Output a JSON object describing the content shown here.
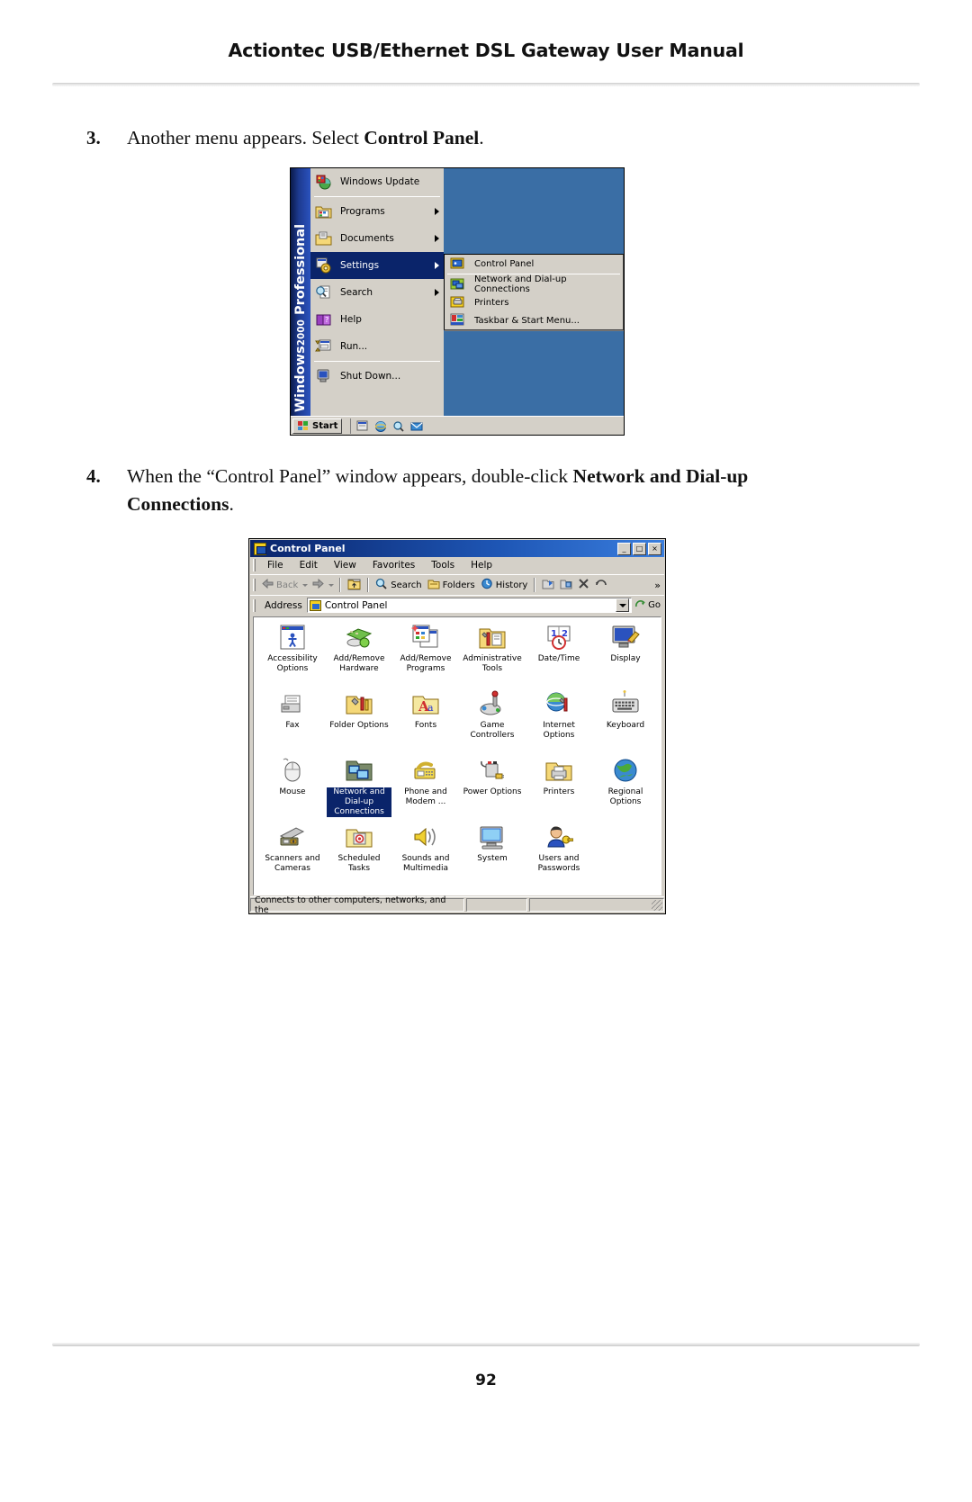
{
  "header": {
    "title": "Actiontec USB/Ethernet DSL Gateway User Manual"
  },
  "footer": {
    "page_number": "92"
  },
  "steps": [
    {
      "number": "3.",
      "text_before": "Another menu appears. Select ",
      "bold_1": "Control Panel",
      "text_after": "."
    },
    {
      "number": "4.",
      "text_before": "When the “Control Panel” window appears, double-click ",
      "bold_1": "Network and Dial-up Connections",
      "text_after": "."
    }
  ],
  "start_menu": {
    "banner_windows": "Windows",
    "banner_2000": "2000",
    "banner_professional": "Professional",
    "items": [
      {
        "label": "Windows Update",
        "icon": "windows-update-icon",
        "arrow": false,
        "selected": false
      },
      {
        "label": "Programs",
        "icon": "programs-folder-icon",
        "arrow": true,
        "selected": false
      },
      {
        "label": "Documents",
        "icon": "documents-folder-icon",
        "arrow": true,
        "selected": false
      },
      {
        "label": "Settings",
        "icon": "settings-gear-icon",
        "arrow": true,
        "selected": true
      },
      {
        "label": "Search",
        "icon": "search-magnifier-icon",
        "arrow": true,
        "selected": false
      },
      {
        "label": "Help",
        "icon": "help-book-icon",
        "arrow": false,
        "selected": false
      },
      {
        "label": "Run...",
        "icon": "run-icon",
        "arrow": false,
        "selected": false
      },
      {
        "label": "Shut Down...",
        "icon": "shutdown-icon",
        "arrow": false,
        "selected": false
      }
    ],
    "submenu": [
      {
        "label": "Control Panel",
        "icon": "control-panel-icon"
      },
      {
        "label": "Network and Dial-up Connections",
        "icon": "network-connections-icon"
      },
      {
        "label": "Printers",
        "icon": "printers-icon"
      },
      {
        "label": "Taskbar & Start Menu...",
        "icon": "taskbar-start-menu-icon"
      }
    ],
    "taskbar": {
      "start_label": "Start",
      "quick_launch": [
        "show-desktop-icon",
        "internet-explorer-icon",
        "search-icon",
        "outlook-express-icon"
      ]
    }
  },
  "control_panel": {
    "title": "Control Panel",
    "window_buttons": {
      "minimize": "_",
      "maximize": "□",
      "close": "×"
    },
    "menu": [
      {
        "label": "File",
        "accel": "F"
      },
      {
        "label": "Edit",
        "accel": "E"
      },
      {
        "label": "View",
        "accel": "V"
      },
      {
        "label": "Favorites",
        "accel": "a"
      },
      {
        "label": "Tools",
        "accel": "T"
      },
      {
        "label": "Help",
        "accel": "H"
      }
    ],
    "toolbar": {
      "back": "Back",
      "forward": "",
      "up": "",
      "search": "Search",
      "folders": "Folders",
      "history": "History",
      "chevron": "»"
    },
    "address": {
      "label": "Address",
      "value": "Control Panel",
      "go_label": "Go"
    },
    "items": [
      {
        "label": "Accessibility Options",
        "icon": "accessibility-options-icon",
        "selected": false
      },
      {
        "label": "Add/Remove Hardware",
        "icon": "add-remove-hardware-icon",
        "selected": false
      },
      {
        "label": "Add/Remove Programs",
        "icon": "add-remove-programs-icon",
        "selected": false
      },
      {
        "label": "Administrative Tools",
        "icon": "administrative-tools-icon",
        "selected": false
      },
      {
        "label": "Date/Time",
        "icon": "date-time-icon",
        "selected": false
      },
      {
        "label": "Display",
        "icon": "display-icon",
        "selected": false
      },
      {
        "label": "Fax",
        "icon": "fax-icon",
        "selected": false
      },
      {
        "label": "Folder Options",
        "icon": "folder-options-icon",
        "selected": false
      },
      {
        "label": "Fonts",
        "icon": "fonts-icon",
        "selected": false
      },
      {
        "label": "Game Controllers",
        "icon": "game-controllers-icon",
        "selected": false
      },
      {
        "label": "Internet Options",
        "icon": "internet-options-icon",
        "selected": false
      },
      {
        "label": "Keyboard",
        "icon": "keyboard-icon",
        "selected": false
      },
      {
        "label": "Mouse",
        "icon": "mouse-icon",
        "selected": false
      },
      {
        "label": "Network and Dial-up Connections",
        "icon": "network-connections-icon",
        "selected": true
      },
      {
        "label": "Phone and Modem ...",
        "icon": "phone-modem-icon",
        "selected": false
      },
      {
        "label": "Power Options",
        "icon": "power-options-icon",
        "selected": false
      },
      {
        "label": "Printers",
        "icon": "printers-icon",
        "selected": false
      },
      {
        "label": "Regional Options",
        "icon": "regional-options-icon",
        "selected": false
      },
      {
        "label": "Scanners and Cameras",
        "icon": "scanners-cameras-icon",
        "selected": false
      },
      {
        "label": "Scheduled Tasks",
        "icon": "scheduled-tasks-icon",
        "selected": false
      },
      {
        "label": "Sounds and Multimedia",
        "icon": "sounds-multimedia-icon",
        "selected": false
      },
      {
        "label": "System",
        "icon": "system-icon",
        "selected": false
      },
      {
        "label": "Users and Passwords",
        "icon": "users-passwords-icon",
        "selected": false
      }
    ],
    "status_bar": {
      "text": "Connects to other computers, networks, and the",
      "pane2": "",
      "pane3": ""
    }
  },
  "colors": {
    "title_bar_blue": "#0a246a",
    "selection_blue": "#0a246a",
    "desktop_blue": "#3a6ea5",
    "window_face": "#d4d0c8"
  }
}
